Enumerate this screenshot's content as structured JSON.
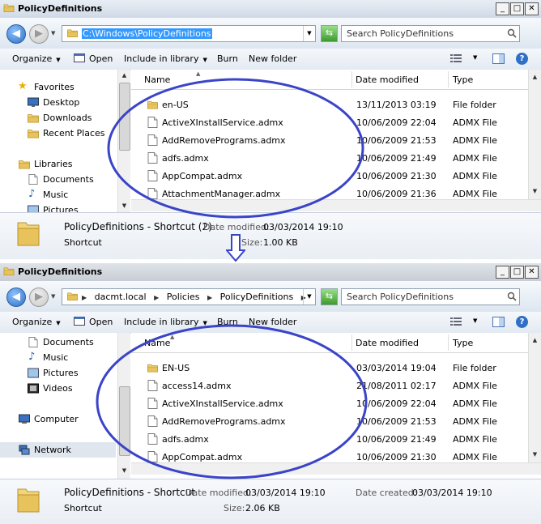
{
  "top_window": {
    "title": "PolicyDefinitions",
    "address_path": "C:\\Windows\\PolicyDefinitions",
    "search_placeholder": "Search PolicyDefinitions",
    "toolbar": {
      "organize": "Organize",
      "open": "Open",
      "include": "Include in library",
      "burn": "Burn",
      "new_folder": "New folder"
    },
    "nav": [
      "Favorites",
      "Desktop",
      "Downloads",
      "Recent Places",
      "Libraries",
      "Documents",
      "Music",
      "Pictures"
    ],
    "columns": {
      "name": "Name",
      "date": "Date modified",
      "type": "Type"
    },
    "files": [
      {
        "name": "en-US",
        "date": "13/11/2013 03:19",
        "type": "File folder",
        "icon": "folder-icon"
      },
      {
        "name": "ActiveXInstallService.admx",
        "date": "10/06/2009 22:04",
        "type": "ADMX File",
        "icon": "file-icon"
      },
      {
        "name": "AddRemovePrograms.admx",
        "date": "10/06/2009 21:53",
        "type": "ADMX File",
        "icon": "file-icon"
      },
      {
        "name": "adfs.admx",
        "date": "10/06/2009 21:49",
        "type": "ADMX File",
        "icon": "file-icon"
      },
      {
        "name": "AppCompat.admx",
        "date": "10/06/2009 21:30",
        "type": "ADMX File",
        "icon": "file-icon"
      },
      {
        "name": "AttachmentManager.admx",
        "date": "10/06/2009 21:36",
        "type": "ADMX File",
        "icon": "file-icon"
      }
    ],
    "details": {
      "name": "PolicyDefinitions - Shortcut (2)",
      "kind": "Shortcut",
      "date_label": "Date modified:",
      "date_value": "03/03/2014 19:10",
      "size_label": "Size:",
      "size_value": "1.00 KB"
    }
  },
  "bottom_window": {
    "title": "PolicyDefinitions",
    "breadcrumbs": [
      "dacmt.local",
      "Policies",
      "PolicyDefinitions"
    ],
    "search_placeholder": "Search PolicyDefinitions",
    "toolbar": {
      "organize": "Organize",
      "open": "Open",
      "include": "Include in library",
      "burn": "Burn",
      "new_folder": "New folder"
    },
    "nav": [
      "Documents",
      "Music",
      "Pictures",
      "Videos",
      "Computer",
      "Network"
    ],
    "selected_nav": "Network",
    "columns": {
      "name": "Name",
      "date": "Date modified",
      "type": "Type"
    },
    "files": [
      {
        "name": "EN-US",
        "date": "03/03/2014 19:04",
        "type": "File folder",
        "icon": "folder-icon"
      },
      {
        "name": "access14.admx",
        "date": "21/08/2011 02:17",
        "type": "ADMX File",
        "icon": "file-icon"
      },
      {
        "name": "ActiveXInstallService.admx",
        "date": "10/06/2009 22:04",
        "type": "ADMX File",
        "icon": "file-icon"
      },
      {
        "name": "AddRemovePrograms.admx",
        "date": "10/06/2009 21:53",
        "type": "ADMX File",
        "icon": "file-icon"
      },
      {
        "name": "adfs.admx",
        "date": "10/06/2009 21:49",
        "type": "ADMX File",
        "icon": "file-icon"
      },
      {
        "name": "AppCompat.admx",
        "date": "10/06/2009 21:30",
        "type": "ADMX File",
        "icon": "file-icon"
      }
    ],
    "details": {
      "name": "PolicyDefinitions - Shortcut",
      "kind": "Shortcut",
      "date_label": "Date modified:",
      "date_value": "03/03/2014 19:10",
      "size_label": "Size:",
      "size_value": "2.06 KB",
      "created_label": "Date created:",
      "created_value": "03/03/2014 19:10"
    }
  },
  "colors": {
    "annotation": "#3a44c8",
    "selection": "#3399ff",
    "folder": "#e8c25a"
  }
}
